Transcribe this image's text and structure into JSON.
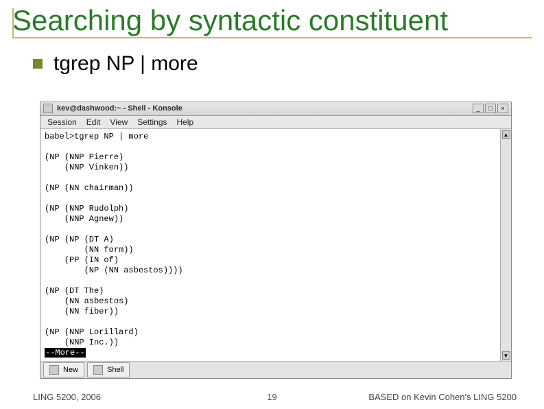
{
  "slide": {
    "title": "Searching by syntactic constituent",
    "bullet_text": "tgrep NP | more"
  },
  "terminal": {
    "window_title": "kev@dashwood:~ - Shell - Konsole",
    "menu": {
      "session": "Session",
      "edit": "Edit",
      "view": "View",
      "settings": "Settings",
      "help": "Help"
    },
    "output_pre": "babel>tgrep NP | more\n\n(NP (NNP Pierre)\n    (NNP Vinken))\n\n(NP (NN chairman))\n\n(NP (NNP Rudolph)\n    (NNP Agnew))\n\n(NP (NP (DT A)\n        (NN form))\n    (PP (IN of)\n        (NP (NN asbestos))))\n\n(NP (DT The)\n    (NN asbestos)\n    (NN fiber))\n\n(NP (NNP Lorillard)\n    (NNP Inc.))\n",
    "more_prompt": "--More--",
    "status_new": "New",
    "status_shell": "Shell",
    "titlebar_buttons": {
      "min": "_",
      "max": "□",
      "close": "×"
    },
    "scroll_up": "▲",
    "scroll_down": "▼"
  },
  "footer": {
    "left": "LING 5200, 2006",
    "center": "19",
    "right": "BASED on Kevin Cohen's LING 5200"
  }
}
